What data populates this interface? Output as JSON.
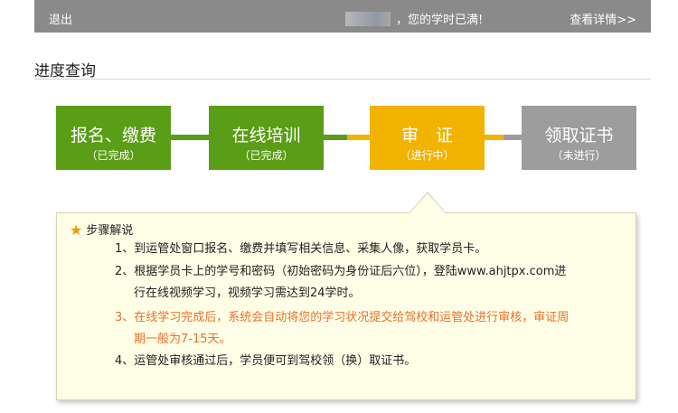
{
  "header": {
    "logout_label": "退出",
    "message": "，您的学时已满!",
    "details_label": "查看详情>>"
  },
  "page_title": "进度查询",
  "steps": [
    {
      "name": "报名、缴费",
      "status": "（已完成）"
    },
    {
      "name": "在线培训",
      "status": "（已完成）"
    },
    {
      "name": "审　证",
      "status": "（进行中）"
    },
    {
      "name": "领取证书",
      "status": "（未进行）"
    }
  ],
  "colors": {
    "done": "#5a9d17",
    "in_progress": "#f2b200",
    "pending": "#9d9d9d",
    "highlight_text": "#e8702a"
  },
  "explanation": {
    "heading": "步骤解说",
    "icon": "star-icon",
    "items": [
      {
        "line1": "1、到运管处窗口报名、缴费并填写相关信息、采集人像，获取学员卡。"
      },
      {
        "line1": "2、根据学员卡上的学号和密码（初始密码为身份证后六位），登陆www.ahjtpx.com进",
        "line2": "行在线视频学习，视频学习需达到24学时。"
      },
      {
        "line1": "3、在线学习完成后，系统会自动将您的学习状况提交给驾校和运管处进行审核，审证周",
        "line2": "期一般为7-15天。"
      },
      {
        "line1": "4、运管处审核通过后，学员便可到驾校领（换）取证书。"
      }
    ]
  }
}
